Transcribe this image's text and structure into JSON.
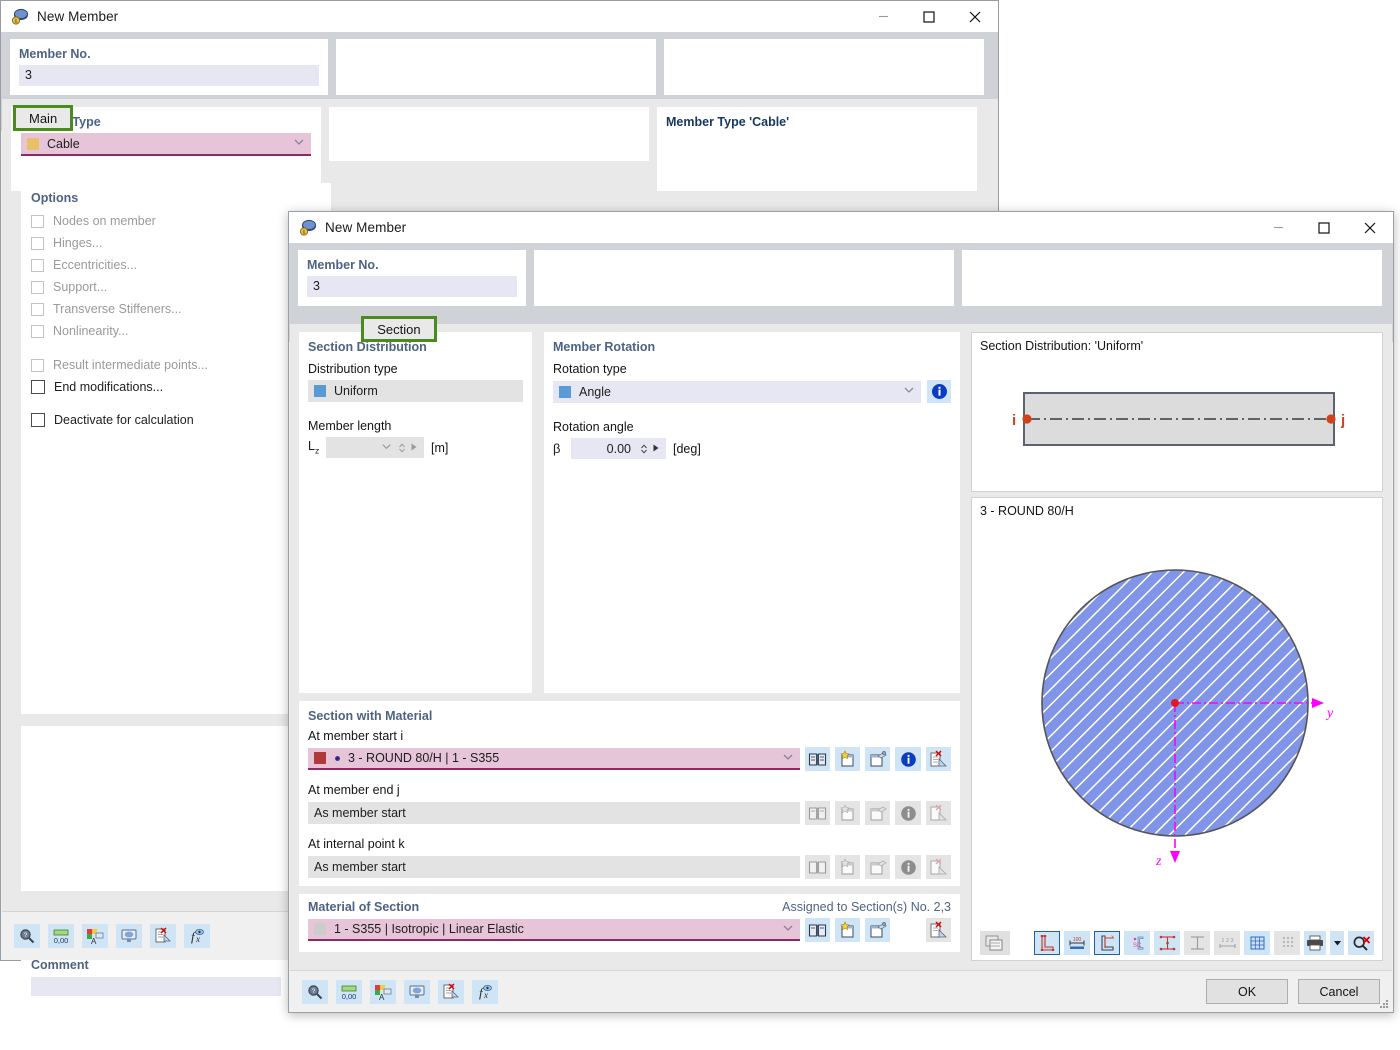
{
  "background_window": {
    "title": "New Member",
    "icon": "member-icon",
    "window_buttons": {
      "minimize": "minimize-icon",
      "maximize": "maximize-icon",
      "close": "close-icon"
    },
    "member_no": {
      "label": "Member No.",
      "value": "3"
    },
    "tabs": [
      {
        "label": "Main",
        "selected": true
      },
      {
        "label": "Section",
        "selected": false
      }
    ],
    "member_type": {
      "label": "Member Type",
      "value": "Cable",
      "swatch": "#e8c06a"
    },
    "options": {
      "label": "Options",
      "items": [
        {
          "label": "Nodes on member",
          "checked": false,
          "disabled": true
        },
        {
          "label": "Hinges...",
          "checked": false,
          "disabled": true
        },
        {
          "label": "Eccentricities...",
          "checked": false,
          "disabled": true
        },
        {
          "label": "Support...",
          "checked": false,
          "disabled": true
        },
        {
          "label": "Transverse Stiffeners...",
          "checked": false,
          "disabled": true
        },
        {
          "label": "Nonlinearity...",
          "checked": false,
          "disabled": true
        },
        {
          "label": "Result intermediate points...",
          "checked": false,
          "disabled": true
        },
        {
          "label": "End modifications...",
          "checked": false,
          "disabled": false
        },
        {
          "label": "Deactivate for calculation",
          "checked": false,
          "disabled": false
        }
      ]
    },
    "info_panel_text": "Member Type 'Cable'",
    "comment": {
      "label": "Comment",
      "value": ""
    },
    "toolbar_icons": [
      "magnifier-icon",
      "decimal-places-icon",
      "display-properties-icon",
      "visual-settings-icon",
      "delete-row-icon",
      "formula-icon"
    ]
  },
  "dialog": {
    "title": "New Member",
    "icon": "member-icon",
    "window_buttons": {
      "minimize": "minimize-icon",
      "maximize": "maximize-icon",
      "close": "close-icon"
    },
    "member_no": {
      "label": "Member No.",
      "value": "3"
    },
    "tabs": [
      {
        "label": "Main",
        "selected": false
      },
      {
        "label": "Section",
        "selected": true
      }
    ],
    "section_distribution": {
      "title": "Section Distribution",
      "distribution_type_label": "Distribution type",
      "distribution_type_value": "Uniform",
      "distribution_type_swatch": "#5b9bd5",
      "member_length_label": "Member length",
      "member_length_symbol": "L",
      "member_length_subscript": "z",
      "member_length_value": "",
      "member_length_unit": "[m]"
    },
    "member_rotation": {
      "title": "Member Rotation",
      "rotation_type_label": "Rotation type",
      "rotation_type_value": "Angle",
      "rotation_type_swatch": "#5b9bd5",
      "rotation_angle_label": "Rotation angle",
      "rotation_angle_symbol": "β",
      "rotation_angle_value": "0.00",
      "rotation_angle_unit": "[deg]",
      "info_icon": "info-icon"
    },
    "section_with_material": {
      "title": "Section with Material",
      "rows": [
        {
          "label": "At member start i",
          "value": "3 - ROUND 80/H | 1 - S355",
          "swatch": "#b03a3a",
          "bullet": true,
          "state": "active",
          "buttons": [
            "library-icon",
            "new-icon",
            "edit-icon",
            "info-icon",
            "delete-icon"
          ]
        },
        {
          "label": "At member end j",
          "value": "As member start",
          "swatch": null,
          "bullet": false,
          "state": "disabled",
          "buttons": [
            "library-icon",
            "new-icon",
            "edit-icon",
            "info-icon",
            "delete-icon"
          ]
        },
        {
          "label": "At internal point k",
          "value": "As member start",
          "swatch": null,
          "bullet": false,
          "state": "disabled",
          "buttons": [
            "library-icon",
            "new-icon",
            "edit-icon",
            "info-icon",
            "delete-icon"
          ]
        }
      ]
    },
    "material_of_section": {
      "title": "Material of Section",
      "assigned_text": "Assigned to Section(s) No. 2,3",
      "value": "1 - S355 | Isotropic | Linear Elastic",
      "swatch": "#cccccc",
      "buttons": [
        "library-icon",
        "new-icon",
        "edit-icon",
        "delete-icon"
      ]
    },
    "preview_top": {
      "caption": "Section Distribution: 'Uniform'",
      "node_start": "i",
      "node_end": "j"
    },
    "preview_bottom": {
      "caption": "3 - ROUND 80/H",
      "axis_y": "y",
      "axis_z": "z",
      "fill_color": "#8094e8",
      "outline_color": "#555555",
      "axis_color": "#ff00ff"
    },
    "preview_toolbar": {
      "left_icon": "image-copy-icon",
      "icons": [
        "section-dimensions-icon",
        "width-dimension-icon",
        "centroid-axes-icon",
        "shear-center-icon",
        "stress-points-icon",
        "parts-icon",
        "numbering-icon",
        "grid-icon",
        "dotted-grid-icon",
        "print-icon",
        "print-dropdown-icon",
        "reset-view-icon"
      ]
    },
    "footer_toolbar_icons": [
      "magnifier-icon",
      "decimal-places-icon",
      "display-properties-icon",
      "visual-settings-icon",
      "delete-row-icon",
      "formula-icon"
    ],
    "ok_label": "OK",
    "cancel_label": "Cancel"
  },
  "colors": {
    "accent_header": "#4e6384",
    "pink_field": "#e7c5d8",
    "pink_underline": "#8e2a63",
    "lavender_field": "#e6e7f3",
    "selected_tab_outline": "#4a8b1e",
    "icon_button_bg": "#cfe4f5"
  }
}
